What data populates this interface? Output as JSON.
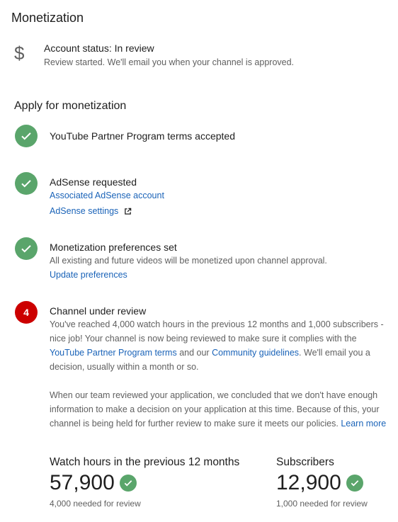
{
  "page": {
    "title": "Monetization"
  },
  "account": {
    "icon": "dollar-icon",
    "status": "Account status: In review",
    "description": "Review started. We'll email you when your channel is approved."
  },
  "apply": {
    "title": "Apply for monetization",
    "steps": [
      {
        "state": "done",
        "title": "YouTube Partner Program terms accepted"
      },
      {
        "state": "done",
        "title": "AdSense requested",
        "links": [
          "Associated AdSense account",
          "AdSense settings"
        ]
      },
      {
        "state": "done",
        "title": "Monetization preferences set",
        "description": "All existing and future videos will be monetized upon channel approval.",
        "links": [
          "Update preferences"
        ]
      },
      {
        "state": "pending",
        "number": "4",
        "title": "Channel under review",
        "p1_a": "You've reached 4,000 watch hours in the previous 12 months and 1,000 subscribers - nice job! Your channel is now being reviewed to make sure it complies with the ",
        "p1_link1": "YouTube Partner Program terms",
        "p1_b": " and our ",
        "p1_link2": "Community guidelines",
        "p1_c": ". We'll email you a decision, usually within a month or so.",
        "p2_a": "When our team reviewed your application, we concluded that we don't have enough information to make a decision on your application at this time. Because of this, your channel is being held for further review to make sure it meets our policies. ",
        "p2_link": "Learn more"
      }
    ]
  },
  "metrics": [
    {
      "label": "Watch hours in the previous 12 months",
      "value": "57,900",
      "note": "4,000 needed for review"
    },
    {
      "label": "Subscribers",
      "value": "12,900",
      "note": "1,000 needed for review"
    }
  ],
  "colors": {
    "check_green": "#5aa56b",
    "alert_red": "#cc0000",
    "link_blue": "#1a63b8"
  }
}
